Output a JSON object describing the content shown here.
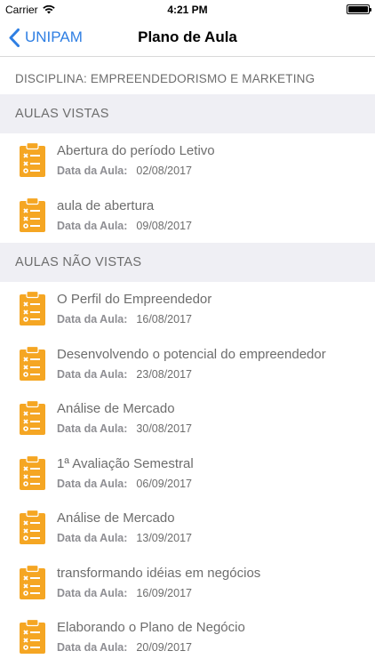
{
  "status_bar": {
    "carrier": "Carrier",
    "time": "4:21 PM"
  },
  "nav": {
    "back_label": "UNIPAM",
    "title": "Plano de Aula"
  },
  "discipline": "DISCIPLINA: EMPREENDEDORISMO E MARKETING",
  "date_label": "Data da Aula:",
  "colors": {
    "accent": "#2f7fe3",
    "icon": "#f5a623",
    "section_bg": "#efeff4"
  },
  "sections": [
    {
      "header": "AULAS VISTAS",
      "items": [
        {
          "title": "Abertura do período Letivo",
          "date": "02/08/2017"
        },
        {
          "title": "aula de abertura",
          "date": "09/08/2017"
        }
      ]
    },
    {
      "header": "AULAS NÃO VISTAS",
      "items": [
        {
          "title": "O Perfil do Empreendedor",
          "date": "16/08/2017"
        },
        {
          "title": "Desenvolvendo o potencial do empreendedor",
          "date": "23/08/2017"
        },
        {
          "title": "Análise de Mercado",
          "date": "30/08/2017"
        },
        {
          "title": "1ª Avaliação Semestral",
          "date": "06/09/2017"
        },
        {
          "title": "Análise de Mercado",
          "date": "13/09/2017"
        },
        {
          "title": "transformando idéias em negócios",
          "date": "16/09/2017"
        },
        {
          "title": "Elaborando o Plano de Negócio",
          "date": "20/09/2017"
        }
      ]
    }
  ]
}
